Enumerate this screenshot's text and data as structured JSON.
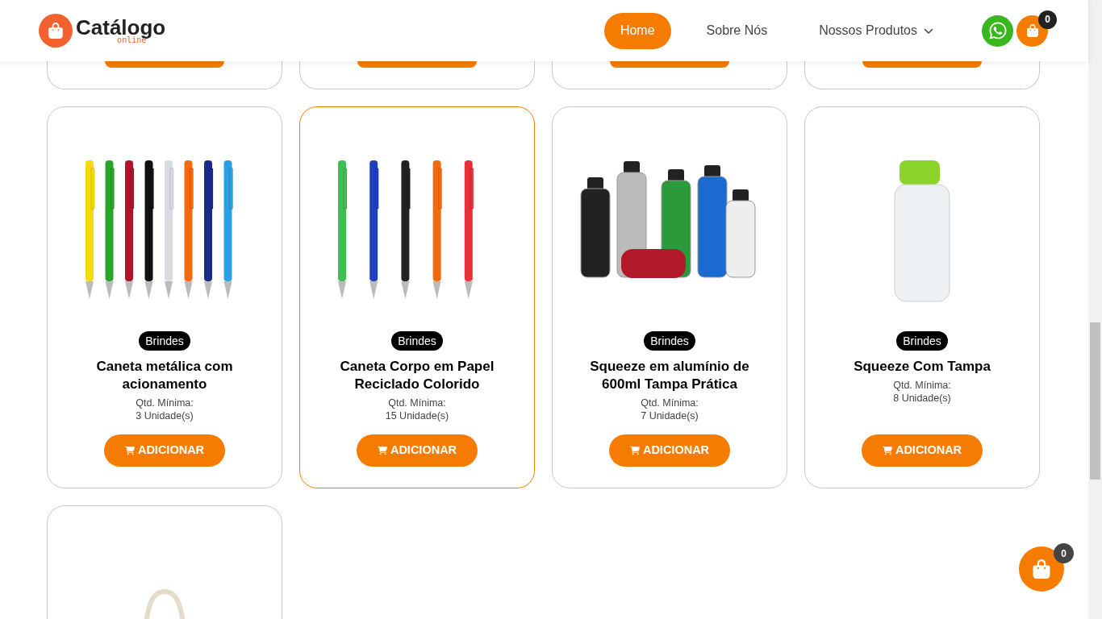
{
  "header": {
    "logo": {
      "name": "Catálogo",
      "tagline": "online"
    },
    "nav": [
      {
        "label": "Home",
        "selected": true,
        "dropdown": false
      },
      {
        "label": "Sobre Nós",
        "selected": false,
        "dropdown": false
      },
      {
        "label": "Nossos Produtos",
        "selected": false,
        "dropdown": true
      }
    ],
    "cart_count": "0"
  },
  "products": [
    {
      "kind": "pens",
      "category": "Brindes",
      "name": "Caneta metálica com acionamento",
      "min_label": "Qtd. Mínima:",
      "min_value": "3 Unidade(s)",
      "button": "ADICIONAR",
      "highlighted": false
    },
    {
      "kind": "pens2",
      "category": "Brindes",
      "name": "Caneta Corpo em Papel Reciclado Colorido",
      "min_label": "Qtd. Mínima:",
      "min_value": "15 Unidade(s)",
      "button": "ADICIONAR",
      "highlighted": true
    },
    {
      "kind": "bottles",
      "category": "Brindes",
      "name": "Squeeze em alumínio de 600ml Tampa Prática",
      "min_label": "Qtd. Mínima:",
      "min_value": "7 Unidade(s)",
      "button": "ADICIONAR",
      "highlighted": false
    },
    {
      "kind": "bottle",
      "category": "Brindes",
      "name": "Squeeze Com Tampa",
      "min_label": "Qtd. Mínima:",
      "min_value": "8 Unidade(s)",
      "button": "ADICIONAR",
      "highlighted": false
    },
    {
      "kind": "bag",
      "highlighted": false
    }
  ],
  "floating_cart_count": "0"
}
